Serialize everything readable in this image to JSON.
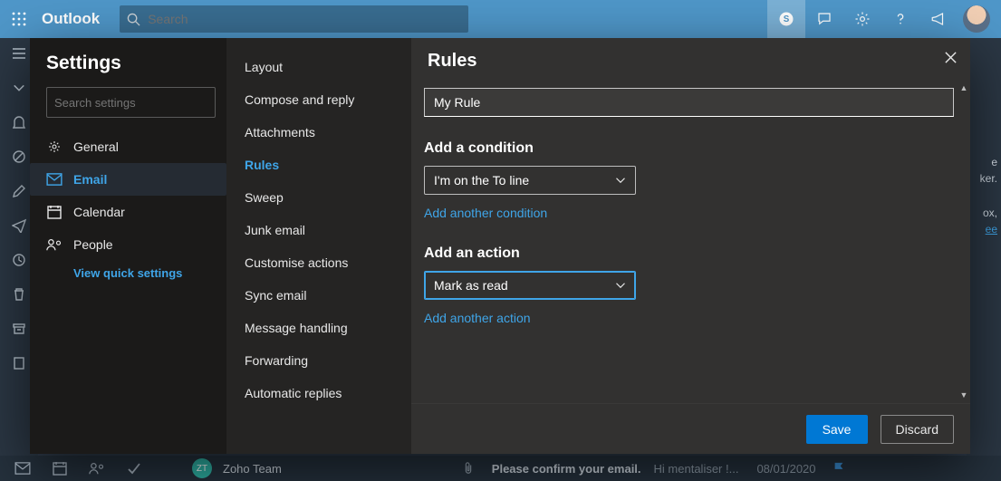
{
  "topbar": {
    "title": "Outlook",
    "search_placeholder": "Search"
  },
  "bottombar": {
    "avatar_initials": "ZT",
    "sender": "Zoho Team",
    "subject": "Please confirm your email.",
    "snippet": "Hi mentaliser !...",
    "date": "08/01/2020"
  },
  "backlog": {
    "l1": "e",
    "l2": "ker.",
    "l3": "ox,",
    "l4": "ee"
  },
  "settings": {
    "title": "Settings",
    "search_placeholder": "Search settings",
    "items": [
      {
        "label": "General"
      },
      {
        "label": "Email"
      },
      {
        "label": "Calendar"
      },
      {
        "label": "People"
      }
    ],
    "quick": "View quick settings"
  },
  "email_sub": {
    "items": [
      {
        "label": "Layout"
      },
      {
        "label": "Compose and reply"
      },
      {
        "label": "Attachments"
      },
      {
        "label": "Rules"
      },
      {
        "label": "Sweep"
      },
      {
        "label": "Junk email"
      },
      {
        "label": "Customise actions"
      },
      {
        "label": "Sync email"
      },
      {
        "label": "Message handling"
      },
      {
        "label": "Forwarding"
      },
      {
        "label": "Automatic replies"
      }
    ]
  },
  "rules": {
    "title": "Rules",
    "name_value": "My Rule",
    "condition_label": "Add a condition",
    "condition_value": "I'm on the To line",
    "add_condition": "Add another condition",
    "action_label": "Add an action",
    "action_value": "Mark as read",
    "add_action": "Add another action",
    "save": "Save",
    "discard": "Discard"
  }
}
